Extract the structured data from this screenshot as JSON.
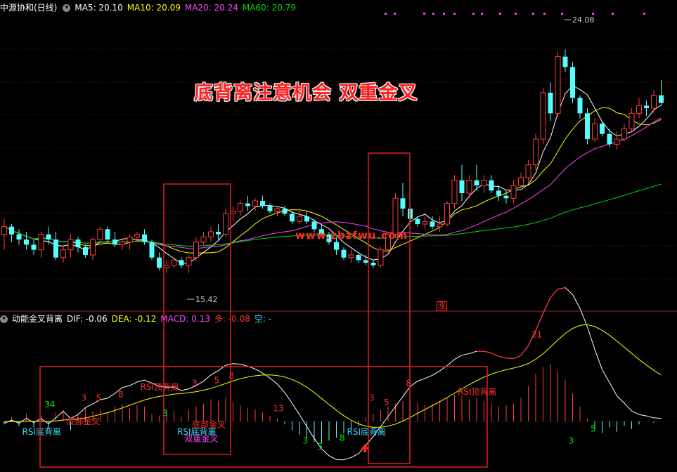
{
  "top_header": {
    "stock_name": "中源协和(日线)",
    "ma5": "MA5: 20.10",
    "ma10": "MA10: 20.09",
    "ma20": "MA20: 20.24",
    "ma60": "MA60: 20.79",
    "colors": {
      "name": "#ffffff",
      "ma5": "#ffffff",
      "ma10": "#ffff00",
      "ma20": "#ff44ff",
      "ma60": "#00dd00"
    }
  },
  "headline": "底背离注意机会 双重金叉",
  "watermark": "www.zbzfwu.com",
  "zhang_label": "涨",
  "bottom_header": {
    "indicator": "动能金叉背离",
    "dif": "DIF: -0.06",
    "dea": "DEA: -0.12",
    "macd": "MACD: 0.13",
    "duo": "多: -0.08",
    "kong": "空: -"
  },
  "chart_data": [
    {
      "type": "candlestick",
      "title": "中源协和(日线)",
      "series_names": [
        "MA5",
        "MA10",
        "MA20",
        "MA60"
      ],
      "max_label": "24.08",
      "min_label": "15.42",
      "ylim": [
        14.0,
        25.4
      ],
      "grid": "horizontal dotted",
      "candles": [
        [
          16.9,
          17.5,
          16.3,
          17.2
        ],
        [
          17.2,
          17.3,
          16.6,
          16.9
        ],
        [
          16.9,
          17.1,
          16.5,
          16.7
        ],
        [
          16.7,
          17.0,
          16.3,
          16.5
        ],
        [
          16.5,
          16.7,
          16.1,
          16.3
        ],
        [
          16.3,
          17.0,
          16.0,
          16.9
        ],
        [
          16.9,
          17.2,
          16.5,
          16.7
        ],
        [
          16.7,
          17.0,
          15.9,
          16.0
        ],
        [
          16.0,
          16.5,
          15.8,
          16.3
        ],
        [
          16.3,
          16.9,
          16.0,
          16.7
        ],
        [
          16.7,
          16.8,
          16.2,
          16.4
        ],
        [
          16.4,
          16.5,
          16.0,
          16.1
        ],
        [
          16.1,
          16.8,
          15.9,
          16.7
        ],
        [
          16.7,
          17.2,
          16.5,
          17.1
        ],
        [
          17.1,
          17.2,
          16.6,
          16.7
        ],
        [
          16.7,
          17.0,
          16.4,
          16.5
        ],
        [
          16.5,
          16.7,
          16.3,
          16.6
        ],
        [
          16.6,
          16.9,
          16.3,
          16.8
        ],
        [
          16.8,
          17.0,
          16.6,
          16.9
        ],
        [
          16.9,
          17.1,
          16.5,
          16.6
        ],
        [
          16.6,
          16.7,
          15.9,
          16.0
        ],
        [
          16.0,
          16.2,
          15.5,
          15.6
        ],
        [
          15.6,
          15.9,
          15.4,
          15.7
        ],
        [
          15.7,
          16.0,
          15.6,
          15.9
        ],
        [
          15.9,
          16.0,
          15.6,
          15.7
        ],
        [
          15.7,
          16.1,
          15.4,
          16.0
        ],
        [
          16.0,
          16.8,
          15.9,
          16.6
        ],
        [
          16.6,
          17.0,
          16.5,
          16.8
        ],
        [
          16.8,
          17.2,
          16.6,
          17.0
        ],
        [
          17.0,
          17.3,
          16.7,
          16.9
        ],
        [
          16.9,
          17.9,
          16.8,
          17.7
        ],
        [
          17.7,
          18.0,
          17.4,
          17.8
        ],
        [
          17.8,
          18.2,
          17.6,
          18.1
        ],
        [
          18.1,
          18.4,
          17.8,
          18.0
        ],
        [
          18.0,
          18.3,
          17.8,
          18.2
        ],
        [
          18.2,
          18.4,
          17.9,
          18.0
        ],
        [
          18.0,
          18.1,
          17.7,
          17.8
        ],
        [
          17.8,
          18.0,
          17.6,
          17.9
        ],
        [
          17.9,
          18.0,
          17.6,
          17.7
        ],
        [
          17.7,
          17.8,
          17.3,
          17.4
        ],
        [
          17.4,
          17.9,
          17.3,
          17.6
        ],
        [
          17.6,
          17.8,
          17.3,
          17.4
        ],
        [
          17.4,
          17.5,
          17.0,
          17.1
        ],
        [
          17.1,
          17.3,
          16.8,
          16.9
        ],
        [
          16.9,
          17.0,
          16.5,
          16.6
        ],
        [
          16.6,
          16.8,
          16.1,
          16.3
        ],
        [
          16.3,
          16.4,
          15.9,
          16.0
        ],
        [
          16.0,
          16.3,
          15.8,
          16.1
        ],
        [
          16.1,
          16.2,
          15.8,
          15.9
        ],
        [
          15.9,
          16.1,
          15.7,
          15.8
        ],
        [
          15.8,
          15.9,
          15.6,
          15.7
        ],
        [
          15.7,
          16.4,
          15.6,
          16.3
        ],
        [
          16.3,
          17.0,
          16.1,
          16.9
        ],
        [
          16.9,
          18.5,
          16.8,
          18.3
        ],
        [
          18.3,
          18.9,
          17.6,
          17.9
        ],
        [
          17.9,
          18.0,
          17.4,
          17.5
        ],
        [
          17.5,
          17.6,
          17.2,
          17.3
        ],
        [
          17.3,
          17.6,
          17.1,
          17.4
        ],
        [
          17.4,
          17.6,
          17.1,
          17.2
        ],
        [
          17.2,
          17.6,
          17.0,
          17.3
        ],
        [
          17.3,
          18.2,
          17.2,
          18.1
        ],
        [
          18.1,
          19.2,
          17.9,
          19.0
        ],
        [
          19.0,
          19.6,
          18.2,
          18.5
        ],
        [
          18.5,
          19.2,
          18.3,
          19.0
        ],
        [
          19.0,
          19.6,
          18.6,
          18.8
        ],
        [
          18.8,
          19.2,
          18.5,
          19.0
        ],
        [
          19.0,
          19.2,
          18.5,
          18.6
        ],
        [
          18.6,
          18.8,
          18.2,
          18.4
        ],
        [
          18.4,
          18.6,
          18.1,
          18.3
        ],
        [
          18.3,
          19.0,
          18.1,
          18.8
        ],
        [
          18.8,
          19.3,
          18.7,
          19.1
        ],
        [
          19.1,
          19.8,
          18.9,
          19.6
        ],
        [
          19.6,
          20.8,
          19.4,
          20.6
        ],
        [
          20.6,
          22.6,
          20.4,
          22.4
        ],
        [
          22.4,
          22.8,
          21.3,
          21.6
        ],
        [
          21.6,
          24.0,
          21.5,
          23.8
        ],
        [
          23.8,
          24.08,
          23.2,
          23.4
        ],
        [
          23.4,
          23.6,
          22.0,
          22.2
        ],
        [
          22.2,
          22.3,
          21.4,
          21.6
        ],
        [
          21.6,
          21.8,
          20.4,
          20.6
        ],
        [
          20.6,
          21.4,
          20.5,
          21.2
        ],
        [
          21.2,
          21.3,
          20.7,
          20.8
        ],
        [
          20.8,
          21.0,
          20.3,
          20.4
        ],
        [
          20.4,
          20.9,
          20.2,
          20.6
        ],
        [
          20.6,
          21.2,
          20.5,
          21.0
        ],
        [
          21.0,
          21.8,
          20.9,
          21.6
        ],
        [
          21.6,
          22.2,
          21.4,
          21.9
        ],
        [
          21.9,
          22.1,
          21.5,
          21.8
        ],
        [
          21.8,
          22.5,
          21.6,
          22.3
        ],
        [
          22.3,
          22.9,
          21.9,
          22.0
        ]
      ]
    },
    {
      "type": "bar",
      "title": "动能金叉背离",
      "series_names": [
        "DIF",
        "DEA",
        "MACD"
      ],
      "macd": [
        -0.02,
        0.03,
        -0.03,
        0.05,
        -0.04,
        0.04,
        -0.05,
        0.06,
        0.08,
        -0.06,
        0.05,
        0.09,
        0.07,
        0.08,
        0.06,
        0.1,
        0.12,
        0.09,
        0.11,
        0.1,
        0.05,
        0.04,
        0.06,
        0.07,
        0.03,
        0.08,
        0.1,
        0.12,
        0.15,
        0.14,
        0.16,
        0.13,
        0.11,
        0.09,
        0.08,
        0.06,
        0.04,
        0.02,
        -0.02,
        -0.06,
        -0.09,
        -0.12,
        -0.14,
        -0.15,
        -0.13,
        -0.11,
        -0.08,
        -0.05,
        -0.03,
        0.03,
        0.05,
        0.08,
        0.1,
        0.12,
        0.14,
        0.16,
        0.13,
        0.11,
        0.12,
        0.14,
        0.16,
        0.18,
        0.17,
        0.15,
        0.16,
        0.14,
        0.12,
        0.1,
        0.11,
        0.12,
        0.16,
        0.24,
        0.32,
        0.37,
        0.39,
        0.34,
        0.28,
        0.19,
        0.1,
        0.02,
        -0.06,
        -0.08,
        -0.04,
        -0.07,
        -0.03,
        -0.05,
        -0.02,
        0.0,
        -0.01,
        0.0
      ],
      "labels": [
        {
          "text": "34",
          "color": "#00ee00",
          "i": 6,
          "v": 0.095
        },
        {
          "text": "底部金叉",
          "color": "#ff3030",
          "i": 9,
          "v": -0.02
        },
        {
          "text": "RSI底背离",
          "color": "#33ddff",
          "i": 3,
          "v": -0.09
        },
        {
          "text": "3",
          "color": "#ff3030",
          "i": 11,
          "v": 0.14
        },
        {
          "text": "5",
          "color": "#ff3030",
          "i": 13,
          "v": 0.14
        },
        {
          "text": "8",
          "color": "#ff3030",
          "i": 16,
          "v": 0.165
        },
        {
          "text": "RSI顶背离",
          "color": "#ff3030",
          "i": 19,
          "v": 0.215
        },
        {
          "text": "3",
          "color": "#00ee00",
          "i": 22,
          "v": 0.035
        },
        {
          "text": "RSI底背离",
          "color": "#33ddff",
          "i": 24,
          "v": -0.09
        },
        {
          "text": "底部金叉",
          "color": "#ff3030",
          "i": 26,
          "v": -0.04
        },
        {
          "text": "双重金叉",
          "color": "#ff44ff",
          "i": 25,
          "v": -0.135
        },
        {
          "text": "3",
          "color": "#ff3030",
          "i": 26,
          "v": 0.24
        },
        {
          "text": "5",
          "color": "#ff3030",
          "i": 29,
          "v": 0.26
        },
        {
          "text": "8",
          "color": "#ff3030",
          "i": 31,
          "v": 0.29
        },
        {
          "text": "13",
          "color": "#ff3030",
          "i": 37,
          "v": 0.07
        },
        {
          "text": "3",
          "color": "#00ee00",
          "i": 41,
          "v": -0.15
        },
        {
          "text": "5",
          "color": "#00ee00",
          "i": 43,
          "v": -0.19
        },
        {
          "text": "RSI底背离",
          "color": "#33ddff",
          "i": 47,
          "v": -0.09
        },
        {
          "text": "8",
          "color": "#00ee00",
          "i": 46,
          "v": -0.13
        },
        {
          "text": "3",
          "color": "#ff3030",
          "i": 50,
          "v": 0.14
        },
        {
          "text": "5",
          "color": "#ff3030",
          "i": 52,
          "v": 0.11
        },
        {
          "text": "8",
          "color": "#ff3030",
          "i": 55,
          "v": 0.24
        },
        {
          "text": "RSI顶背离",
          "color": "#ff3030",
          "i": 62,
          "v": 0.18
        },
        {
          "text": "21",
          "color": "#ff3030",
          "i": 72,
          "v": 0.57
        },
        {
          "text": "3",
          "color": "#00ee00",
          "i": 77,
          "v": -0.15
        },
        {
          "text": "5",
          "color": "#00ee00",
          "i": 80,
          "v": -0.07
        }
      ]
    }
  ]
}
